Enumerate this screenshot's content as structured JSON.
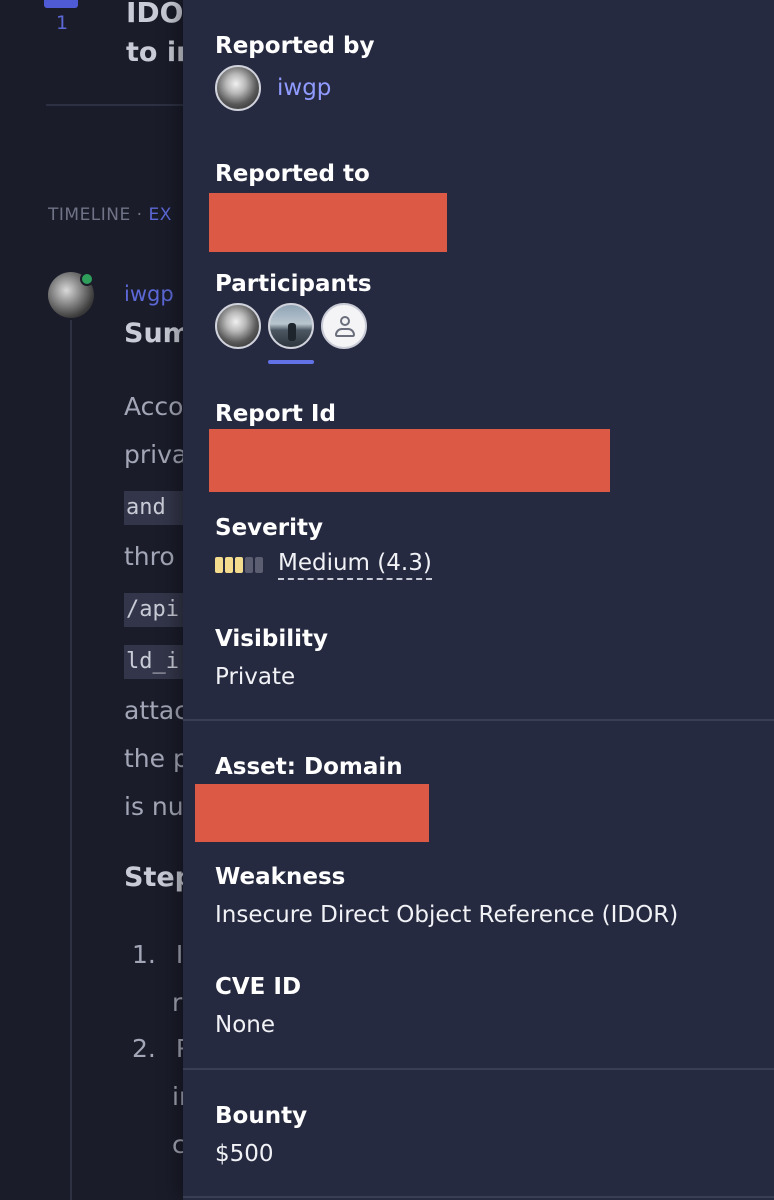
{
  "background": {
    "vote_count": "1",
    "title_line1": "IDO",
    "title_line2": "to in",
    "timeline_label": "TIMELINE",
    "timeline_sep": "·",
    "timeline_expand": "EX",
    "author": "iwgp",
    "summary_heading": "Sum",
    "text_lines": [
      "Acco",
      "priva",
      "thro",
      "attac",
      "the p",
      "is nu"
    ],
    "code_lines": [
      "and",
      "/api",
      "ld_i"
    ],
    "steps_heading": "Step",
    "step_items": [
      {
        "number": "1.",
        "text": "In",
        "cont": "r"
      },
      {
        "number": "2.",
        "text": "R",
        "cont": "ir"
      }
    ],
    "step_tail": "c"
  },
  "panel": {
    "reported_by": {
      "label": "Reported by",
      "user": "iwgp"
    },
    "reported_to": {
      "label": "Reported to"
    },
    "participants": {
      "label": "Participants"
    },
    "report_id": {
      "label": "Report Id"
    },
    "severity": {
      "label": "Severity",
      "value": "Medium (4.3)",
      "level_filled": 3,
      "level_total": 5,
      "color_filled": "#f4dc8e",
      "color_empty": "#5a5e70"
    },
    "visibility": {
      "label": "Visibility",
      "value": "Private"
    },
    "asset": {
      "label": "Asset: Domain"
    },
    "weakness": {
      "label": "Weakness",
      "value": "Insecure Direct Object Reference (IDOR)"
    },
    "cve": {
      "label": "CVE ID",
      "value": "None"
    },
    "bounty": {
      "label": "Bounty",
      "value": "$500"
    }
  },
  "colors": {
    "panel_bg": "#262a40",
    "page_bg": "#1a1c2a",
    "accent": "#8f9bff",
    "redaction": "#dc5a45"
  },
  "icons": {
    "participant_placeholder": "user-outline-icon",
    "severity": "severity-meter-icon"
  }
}
